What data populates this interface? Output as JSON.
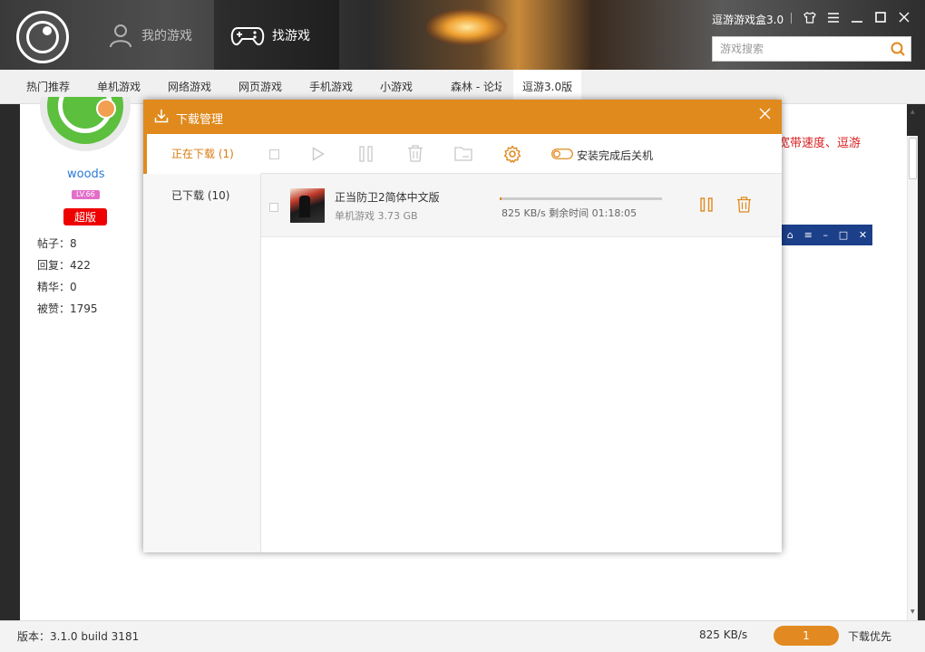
{
  "app": {
    "title": "逗游游戏盒3.0",
    "nav_tabs": [
      {
        "label": "我的游戏",
        "icon": "user-icon"
      },
      {
        "label": "找游戏",
        "icon": "gamepad-icon"
      }
    ],
    "search_placeholder": "游戏搜索"
  },
  "categories": [
    {
      "label": "热门推荐"
    },
    {
      "label": "单机游戏"
    },
    {
      "label": "网络游戏"
    },
    {
      "label": "网页游戏"
    },
    {
      "label": "手机游戏"
    },
    {
      "label": "小游戏"
    },
    {
      "label": "森林 - 论坛"
    },
    {
      "label": "逗游3.0版"
    }
  ],
  "profile": {
    "username": "woods",
    "level": "LV.66",
    "badge": "超版",
    "stats": [
      {
        "label": "帖子：8"
      },
      {
        "label": "回复：422"
      },
      {
        "label": "精华：0"
      },
      {
        "label": "被赞：1795"
      }
    ]
  },
  "background_text": "宽带速度、逗游",
  "dialog": {
    "title": "下载管理",
    "tabs": [
      {
        "label": "正在下载 (1)",
        "active": true
      },
      {
        "label": "已下载 (10)",
        "active": false
      }
    ],
    "toolbar": {
      "shutdown_label": "安装完成后关机"
    },
    "downloads": [
      {
        "name": "正当防卫2简体中文版",
        "category": "单机游戏",
        "size": "3.73 GB",
        "meta": "单机游戏  3.73 GB",
        "progress": 0.01,
        "speed": "825 KB/s",
        "remaining_label": "剩余时间",
        "remaining": "01:18:05",
        "info": "825 KB/s  剩余时间  01:18:05"
      }
    ]
  },
  "status_bar": {
    "version": "版本：3.1.0 build 3181",
    "speed": "825 KB/s",
    "count": "1",
    "priority": "下载优先"
  },
  "colors": {
    "accent": "#e08a1e",
    "link": "#2b7bd6",
    "badge_red": "#e00000",
    "alert_text": "#d81e1e"
  }
}
